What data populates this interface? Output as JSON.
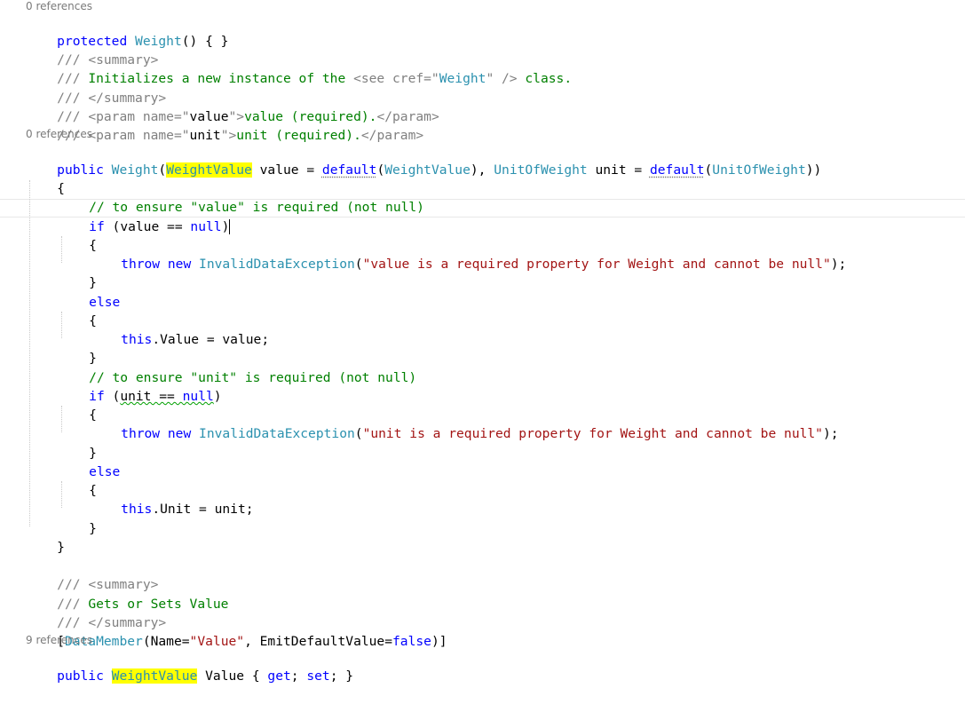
{
  "editor": {
    "codelens": [
      "0 references",
      "0 references",
      "9 references"
    ],
    "lines": {
      "l1": [
        "protected",
        "Weight",
        "() { }"
      ],
      "l2": [
        "///",
        "<summary>"
      ],
      "l3": [
        "///",
        "Initializes a new instance of the",
        "<see cref=\"",
        "Weight",
        "\" />",
        "class."
      ],
      "l4": [
        "///",
        "</summary>"
      ],
      "l5": [
        "///",
        "<param name=\"",
        "value",
        "\">",
        "value (required).",
        "</param>"
      ],
      "l6": [
        "///",
        "<param name=\"",
        "unit",
        "\">",
        "unit (required).",
        "</param>"
      ],
      "l7": [
        "public",
        "Weight",
        "(",
        "WeightValue",
        " value = ",
        "default",
        "(",
        "WeightValue",
        "), ",
        "UnitOfWeight",
        " unit = ",
        "default",
        "(",
        "UnitOfWeight",
        "))"
      ],
      "l8": [
        "{"
      ],
      "l9": [
        "// to ensure \"value\" is required (not null)"
      ],
      "l10": [
        "if",
        "(value == ",
        "null",
        ")"
      ],
      "l11": [
        "{"
      ],
      "l12": [
        "throw",
        "new",
        "InvalidDataException",
        "(",
        "\"value is a required property for Weight and cannot be null\"",
        ");"
      ],
      "l13": [
        "}"
      ],
      "l14": [
        "else"
      ],
      "l15": [
        "{"
      ],
      "l16": [
        "this",
        ".Value = value;"
      ],
      "l17": [
        "}"
      ],
      "l18": [
        "// to ensure \"unit\" is required (not null)"
      ],
      "l19": [
        "if",
        "(",
        "unit == ",
        "null",
        ")"
      ],
      "l20": [
        "{"
      ],
      "l21": [
        "throw",
        "new",
        "InvalidDataException",
        "(",
        "\"unit is a required property for Weight and cannot be null\"",
        ");"
      ],
      "l22": [
        "}"
      ],
      "l23": [
        "else"
      ],
      "l24": [
        "{"
      ],
      "l25": [
        "this",
        ".Unit = unit;"
      ],
      "l26": [
        "}"
      ],
      "l27": [
        "}"
      ],
      "l28": [
        "///",
        "<summary>"
      ],
      "l29": [
        "///",
        "Gets or Sets Value"
      ],
      "l30": [
        "///",
        "</summary>"
      ],
      "l31": [
        "[",
        "DataMember",
        "(Name=",
        "\"Value\"",
        ", EmitDefaultValue=",
        "false",
        ")]"
      ],
      "l32": [
        "public",
        "WeightValue",
        "Value { ",
        "get",
        "; ",
        "set",
        "; }"
      ]
    }
  },
  "colors": {
    "keyword": "#0000ff",
    "type": "#2b91af",
    "string": "#a31515",
    "comment": "#008000",
    "doc_tag": "#808080",
    "highlight": "#ffff00"
  }
}
